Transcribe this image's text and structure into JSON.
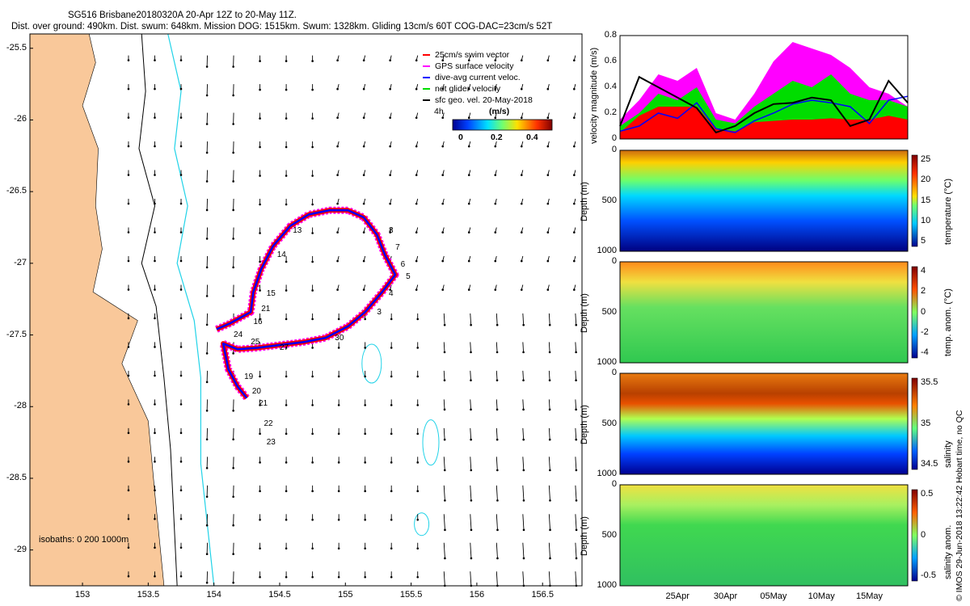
{
  "header": {
    "line1": "SG516 Brisbane20180320A 20-Apr 12Z to 20-May 11Z.",
    "line2": "Dist. over ground: 490km. Dist. swum: 648km. Mission DOG: 1515km. Swum: 1328km. Gliding 13cm/s 60T COG-DAC=23cm/s 52T"
  },
  "side_note": "© IMOS 29-Jun-2018 13:22:42 Hobart time, no QC",
  "colors": {
    "land": "#f9c89a",
    "isobath_200": "#000000",
    "isobath_1000": "#22d3e8",
    "swim": "#ff0000",
    "gps": "#ff00ff",
    "dac": "#0000ff",
    "net": "#00dd00",
    "geo": "#000000"
  },
  "chart_data": [
    {
      "type": "map",
      "xticks": [
        "153",
        "153.5",
        "154",
        "154.5",
        "155",
        "155.5",
        "156",
        "156.5"
      ],
      "yticks": [
        "-25.5",
        "-26",
        "-26.5",
        "-27",
        "-27.5",
        "-28",
        "-28.5",
        "-29"
      ],
      "xlim": [
        152.6,
        156.8
      ],
      "ylim": [
        -29.25,
        -25.4
      ],
      "legend": {
        "items": [
          {
            "key": "swim",
            "label": "25cm/s swim vector"
          },
          {
            "key": "gps",
            "label": "GPS surface velocity"
          },
          {
            "key": "dac",
            "label": "dive-avg current veloc."
          },
          {
            "key": "net",
            "label": "net glider velocity"
          },
          {
            "key": "geo",
            "label": "sfc geo. vel. 20-May-2018"
          }
        ],
        "scale_label": "(m/s)",
        "scale_ticks": [
          "0",
          "0.2",
          "0.4"
        ],
        "extra_label": "4h"
      },
      "isobath_note": "isobaths: 0   200   1000m",
      "track": [
        [
          154.02,
          -27.46
        ],
        [
          154.12,
          -27.42
        ],
        [
          154.2,
          -27.38
        ],
        [
          154.28,
          -27.34
        ],
        [
          154.3,
          -27.2
        ],
        [
          154.36,
          -27.04
        ],
        [
          154.45,
          -26.88
        ],
        [
          154.58,
          -26.74
        ],
        [
          154.72,
          -26.66
        ],
        [
          154.88,
          -26.63
        ],
        [
          155.02,
          -26.63
        ],
        [
          155.14,
          -26.68
        ],
        [
          155.24,
          -26.8
        ],
        [
          155.3,
          -26.94
        ],
        [
          155.38,
          -27.08
        ],
        [
          155.28,
          -27.2
        ],
        [
          155.15,
          -27.34
        ],
        [
          155.02,
          -27.44
        ],
        [
          154.85,
          -27.52
        ],
        [
          154.68,
          -27.55
        ],
        [
          154.5,
          -27.57
        ],
        [
          154.33,
          -27.59
        ],
        [
          154.18,
          -27.6
        ],
        [
          154.07,
          -27.56
        ],
        [
          154.11,
          -27.74
        ],
        [
          154.18,
          -27.86
        ],
        [
          154.25,
          -27.94
        ]
      ],
      "track_labels": [
        {
          "text": "13",
          "lon": 154.6,
          "lat": -26.78
        },
        {
          "text": "14",
          "lon": 154.48,
          "lat": -26.95
        },
        {
          "text": "15",
          "lon": 154.4,
          "lat": -27.22
        },
        {
          "text": "16",
          "lon": 154.3,
          "lat": -27.42
        },
        {
          "text": "21",
          "lon": 154.36,
          "lat": -27.33
        },
        {
          "text": "24",
          "lon": 154.15,
          "lat": -27.51
        },
        {
          "text": "25",
          "lon": 154.28,
          "lat": -27.56
        },
        {
          "text": "27",
          "lon": 154.5,
          "lat": -27.6
        },
        {
          "text": "30",
          "lon": 154.92,
          "lat": -27.53
        },
        {
          "text": "3",
          "lon": 155.24,
          "lat": -27.35
        },
        {
          "text": "4",
          "lon": 155.33,
          "lat": -27.22
        },
        {
          "text": "5",
          "lon": 155.46,
          "lat": -27.1
        },
        {
          "text": "6",
          "lon": 155.42,
          "lat": -27.02
        },
        {
          "text": "7",
          "lon": 155.38,
          "lat": -26.9
        },
        {
          "text": "8",
          "lon": 155.33,
          "lat": -26.78
        },
        {
          "text": "19",
          "lon": 154.23,
          "lat": -27.8
        },
        {
          "text": "20",
          "lon": 154.29,
          "lat": -27.9
        },
        {
          "text": "21",
          "lon": 154.34,
          "lat": -27.99
        },
        {
          "text": "22",
          "lon": 154.38,
          "lat": -28.13
        },
        {
          "text": "23",
          "lon": 154.4,
          "lat": -28.26
        }
      ]
    },
    {
      "type": "area",
      "ylabel": "velocity magnitude (m/s)",
      "ylim": [
        0,
        0.8
      ],
      "yticks": [
        "0",
        "0.2",
        "0.4",
        "0.6",
        "0.8"
      ],
      "x_day": [
        0,
        2,
        4,
        6,
        8,
        10,
        12,
        14,
        16,
        18,
        20,
        22,
        24,
        26,
        28,
        30
      ],
      "series": [
        {
          "key": "gps",
          "values": [
            0.15,
            0.3,
            0.5,
            0.45,
            0.55,
            0.2,
            0.15,
            0.35,
            0.6,
            0.75,
            0.7,
            0.65,
            0.55,
            0.4,
            0.35,
            0.25
          ]
        },
        {
          "key": "net",
          "values": [
            0.1,
            0.2,
            0.35,
            0.3,
            0.4,
            0.15,
            0.12,
            0.25,
            0.35,
            0.45,
            0.4,
            0.5,
            0.35,
            0.3,
            0.3,
            0.25
          ]
        },
        {
          "key": "swim",
          "values": [
            0.05,
            0.18,
            0.25,
            0.25,
            0.25,
            0.08,
            0.06,
            0.13,
            0.14,
            0.15,
            0.15,
            0.16,
            0.15,
            0.15,
            0.18,
            0.15
          ]
        },
        {
          "key": "dac",
          "values": [
            0.06,
            0.1,
            0.2,
            0.16,
            0.28,
            0.08,
            0.05,
            0.14,
            0.2,
            0.27,
            0.3,
            0.28,
            0.25,
            0.12,
            0.3,
            0.33
          ]
        },
        {
          "key": "geo",
          "values": [
            0.1,
            0.48,
            0.4,
            0.32,
            0.24,
            0.05,
            0.1,
            0.2,
            0.27,
            0.28,
            0.32,
            0.3,
            0.1,
            0.15,
            0.45,
            0.28
          ]
        }
      ]
    },
    {
      "type": "heatmap",
      "ylabel": "Depth (m)",
      "yticks": [
        "0",
        "500",
        "1000"
      ],
      "colorbar_label": "temperature (°C)",
      "colorbar_ticks": [
        "25",
        "20",
        "15",
        "10",
        "5"
      ]
    },
    {
      "type": "heatmap",
      "ylabel": "Depth (m)",
      "yticks": [
        "0",
        "500",
        "1000"
      ],
      "colorbar_label": "temp. anom. (°C)",
      "colorbar_ticks": [
        "4",
        "2",
        "0",
        "-2",
        "-4"
      ]
    },
    {
      "type": "heatmap",
      "ylabel": "Depth (m)",
      "yticks": [
        "0",
        "500",
        "1000"
      ],
      "colorbar_label": "salinity",
      "colorbar_ticks": [
        "35.5",
        "35",
        "34.5"
      ]
    },
    {
      "type": "heatmap",
      "ylabel": "Depth (m)",
      "yticks": [
        "0",
        "500",
        "1000"
      ],
      "colorbar_label": "salinity anom.",
      "colorbar_ticks": [
        "0.5",
        "0",
        "-0.5"
      ],
      "xticks": [
        "25Apr",
        "30Apr",
        "05May",
        "10May",
        "15May"
      ]
    }
  ]
}
